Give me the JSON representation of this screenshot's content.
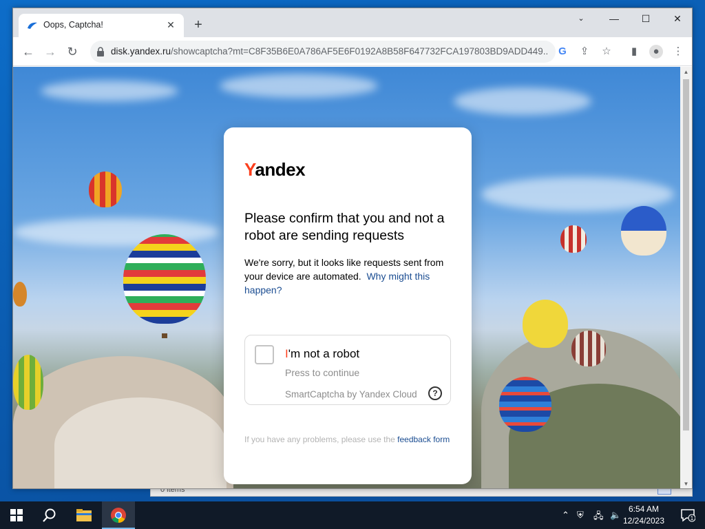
{
  "browser": {
    "tab_title": "Oops, Captcha!",
    "url_host": "disk.yandex.ru",
    "url_rest": "/showcaptcha?mt=C8F35B6E0A786AF5E6F0192A8B58F647732FCA197803BD9ADD449..."
  },
  "captcha": {
    "logo_first": "Y",
    "logo_rest": "andex",
    "heading": "Please confirm that you and not a robot are sending requests",
    "desc_text": "We're sorry, but it looks like requests sent from your device are automated.",
    "desc_link": "Why might this happen?",
    "robot_first": "I",
    "robot_rest": "'m not a robot",
    "press": "Press to continue",
    "smart": "SmartCaptcha by Yandex Cloud",
    "help": "?",
    "footer_text": "If you have any problems, please use the",
    "footer_link": "feedback form"
  },
  "behind_window": {
    "status_text": "0 items"
  },
  "taskbar": {
    "time": "6:54 AM",
    "date": "12/24/2023",
    "notification_count": "1"
  },
  "colors": {
    "yandex_red": "#fc3f1d",
    "link_blue": "#1a4c91"
  },
  "icons": [
    "back-arrow-icon",
    "forward-arrow-icon",
    "reload-icon",
    "lock-icon",
    "google-icon",
    "share-icon",
    "star-icon",
    "sidepanel-icon",
    "profile-icon",
    "menu-icon",
    "windows-start-icon",
    "search-icon",
    "file-explorer-icon",
    "chrome-icon"
  ]
}
